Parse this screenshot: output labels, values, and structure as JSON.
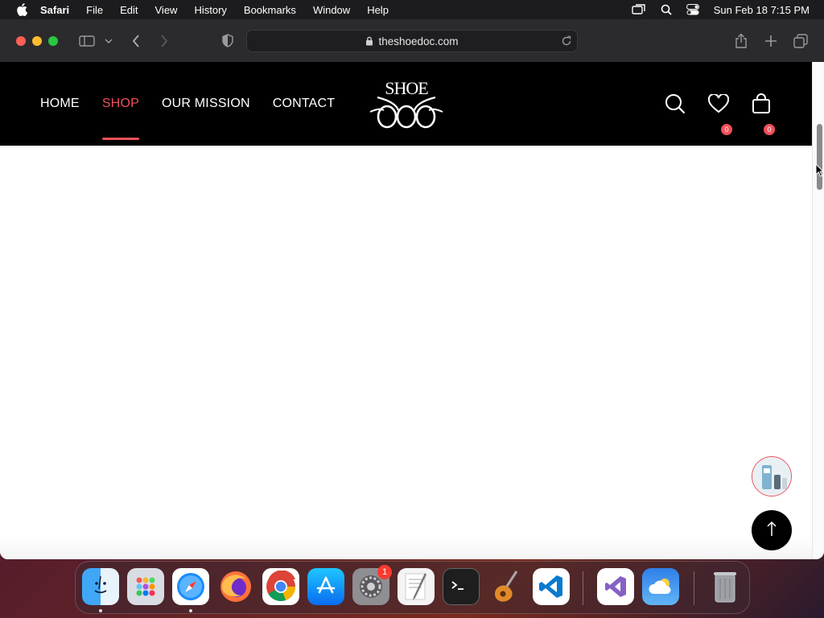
{
  "menubar": {
    "app_name": "Safari",
    "items": [
      "File",
      "Edit",
      "View",
      "History",
      "Bookmarks",
      "Window",
      "Help"
    ],
    "datetime": "Sun Feb 18  7:15 PM"
  },
  "browser": {
    "url": "theshoedoc.com"
  },
  "site": {
    "nav": [
      "HOME",
      "SHOP",
      "OUR MISSION",
      "CONTACT"
    ],
    "active_nav": "SHOP",
    "logo_text": "SHOE",
    "wishlist_count": "0",
    "cart_count": "0"
  },
  "dock": {
    "apps": [
      "Finder",
      "Launchpad",
      "Safari",
      "Firefox",
      "Chrome",
      "App Store",
      "System Settings",
      "TextEdit",
      "Terminal",
      "GarageBand",
      "Visual Studio Code",
      "Visual Studio",
      "Weather",
      "Trash"
    ],
    "settings_badge": "1"
  },
  "colors": {
    "accent": "#f0505a",
    "header_bg": "#000000"
  }
}
